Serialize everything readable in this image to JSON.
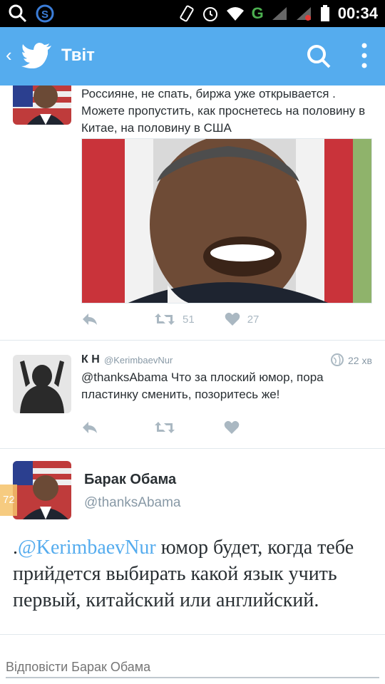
{
  "status_bar": {
    "time": "00:34",
    "network": "G"
  },
  "header": {
    "title": "Твіт"
  },
  "tweets": [
    {
      "text": "Россияне, не спать, биржа уже открывается . Можете пропустить, как проснетесь на половину в Китае, на половину в США",
      "retweets": "51",
      "likes": "27"
    },
    {
      "name": "К Н",
      "handle": "@KerimbaevNur",
      "time": "22 хв",
      "text": "@thanksAbama Что за плоский юмор, пора пластинку сменить, позоритесь же!"
    }
  ],
  "main_tweet": {
    "name": "Барак Обама",
    "handle": "@thanksAbama",
    "prefix": ".",
    "mention": "@KerimbaevNur",
    "text": " юмор будет, когда тебе прийдется выбирать какой язык учить первый, китайский или английский."
  },
  "side_badge": "72",
  "reply": {
    "placeholder": "Відповісти Барак Обама"
  }
}
